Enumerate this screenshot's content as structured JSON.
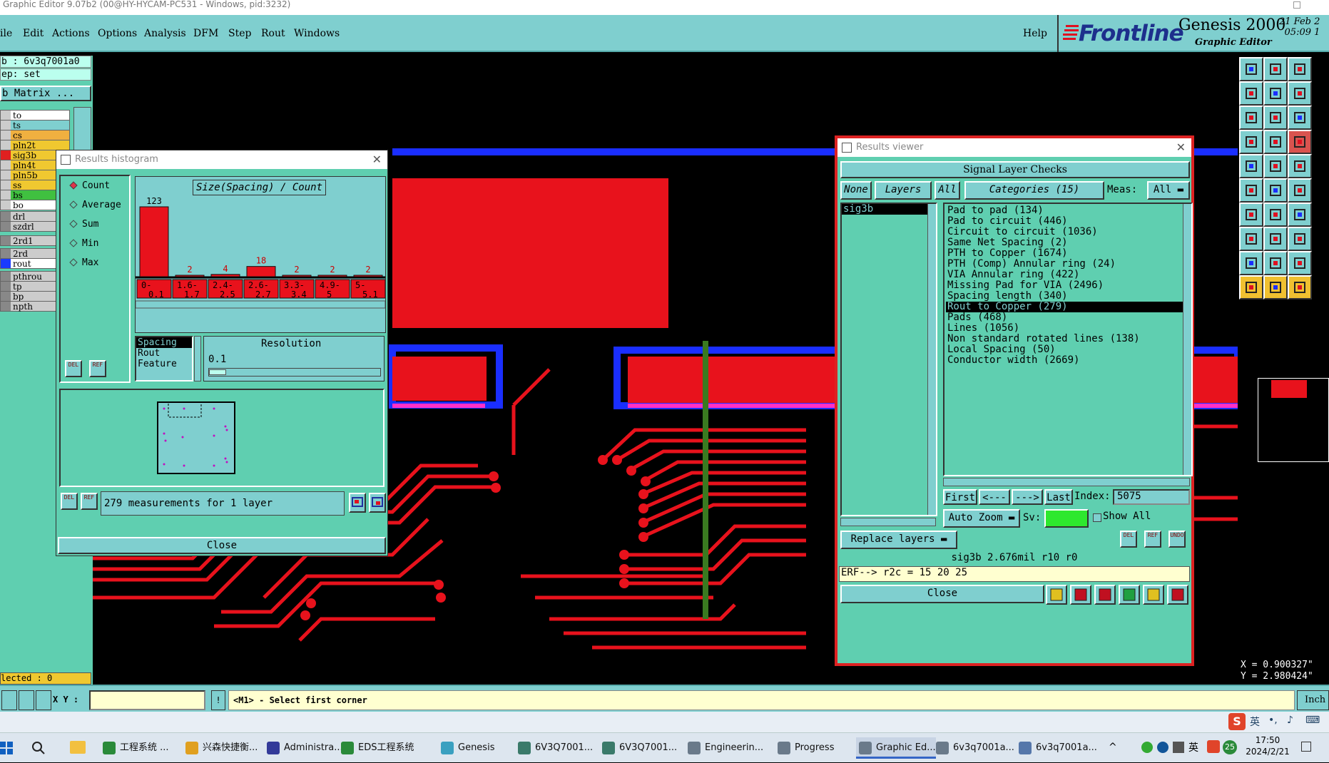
{
  "window_title": "Graphic Editor 9.07b2 (00@HY-HYCAM-PC531 - Windows, pid:3232)",
  "menu": {
    "items": [
      "ile",
      "Edit",
      "Actions",
      "Options",
      "Analysis",
      "DFM",
      "Step",
      "Rout",
      "Windows"
    ],
    "help": "Help"
  },
  "brand": {
    "logo": "Frontline",
    "product": "Genesis 2000",
    "subtitle": "Graphic Editor",
    "date_line1": "21 Feb 2",
    "date_line2": "05:09 1"
  },
  "left_panel": {
    "job": "b : 6v3q7001a0",
    "step": "ep: set",
    "matrix": "b Matrix ...",
    "layers": [
      {
        "name": "to",
        "bg": "#ffffff",
        "sw": "#cccccc"
      },
      {
        "name": "ts",
        "bg": "#7fcfcf",
        "sw": "#cccccc"
      },
      {
        "name": "cs",
        "bg": "#f0b040",
        "sw": "#cccccc"
      },
      {
        "name": "pln2t",
        "bg": "#f0c830",
        "sw": "#cccccc"
      },
      {
        "name": "sig3b",
        "bg": "#f0c830",
        "sw": "#e02020"
      },
      {
        "name": "pln4t",
        "bg": "#f0c830",
        "sw": "#cccccc"
      },
      {
        "name": "pln5b",
        "bg": "#f0c830",
        "sw": "#cccccc"
      },
      {
        "name": "ss",
        "bg": "#f0c830",
        "sw": "#cccccc"
      },
      {
        "name": "bs",
        "bg": "#40c040",
        "sw": "#cccccc"
      },
      {
        "name": "bo",
        "bg": "#ffffff",
        "sw": "#cccccc"
      },
      {
        "name": "drl",
        "bg": "#cccccc",
        "sw": "#888888"
      },
      {
        "name": "szdrl",
        "bg": "#cccccc",
        "sw": "#888888"
      },
      {
        "name": "2rd1",
        "bg": "#cccccc",
        "sw": "#888888"
      },
      {
        "name": "2rd",
        "bg": "#cccccc",
        "sw": "#888888"
      },
      {
        "name": "rout",
        "bg": "#ffffff",
        "sw": "#1a3aff"
      },
      {
        "name": "pthrou",
        "bg": "#cccccc",
        "sw": "#888888"
      },
      {
        "name": "tp",
        "bg": "#cccccc",
        "sw": "#888888"
      },
      {
        "name": "bp",
        "bg": "#cccccc",
        "sw": "#888888"
      },
      {
        "name": "npth",
        "bg": "#cccccc",
        "sw": "#888888"
      }
    ],
    "selected": "lected : 0"
  },
  "histogram": {
    "title": "Results histogram",
    "modes": [
      "Count",
      "Average",
      "Sum",
      "Min",
      "Max"
    ],
    "selected_mode": "Count",
    "chart_title": "Size(Spacing) / Count",
    "fields": [
      "Spacing",
      "Rout",
      "Feature"
    ],
    "resolution_label": "Resolution",
    "resolution_value": "0.1",
    "summary": "279 measurements for 1 layer",
    "close": "Close",
    "del": "DEL",
    "ref": "REF"
  },
  "chart_data": {
    "type": "bar",
    "title": "Size(Spacing) / Count",
    "categories": [
      "0-0.1",
      "1.6-1.7",
      "2.4-2.5",
      "2.6-2.7",
      "3.3-3.4",
      "4.9-5",
      "5-5.1"
    ],
    "values": [
      123,
      2,
      4,
      18,
      2,
      2,
      2
    ],
    "ylim": [
      0,
      123
    ]
  },
  "viewer": {
    "title": "Results viewer",
    "header": "Signal Layer Checks",
    "none": "None",
    "layers": "Layers",
    "all": "All",
    "categories_btn": "Categories (15)",
    "meas_label": "Meas:",
    "meas_value": "All",
    "layer_list": [
      "sig3b"
    ],
    "categories": [
      "Pad to pad (134)",
      "Pad to circuit (446)",
      "Circuit to circuit (1036)",
      "Same Net Spacing (2)",
      "PTH to Copper (1674)",
      "PTH (Comp) Annular ring (24)",
      "VIA Annular ring (422)",
      "Missing Pad for VIA (2496)",
      "Spacing length (340)",
      "Rout to Copper (279)",
      "Pads (468)",
      "Lines (1056)",
      "Non standard rotated lines (138)",
      "Local Spacing (50)",
      "Conductor width (2669)"
    ],
    "selected_category": "Rout to Copper (279)",
    "first": "First",
    "prev": "<---",
    "next": "--->",
    "last": "Last",
    "index_label": "Index:",
    "index_value": "5075",
    "auto_zoom": "Auto Zoom",
    "sv_label": "Sv:",
    "show_all": "Show All",
    "replace_layers": "Replace layers",
    "status": "sig3b 2.676mil  r10  r0",
    "erf": "ERF--> r2c = 15 20 25",
    "close": "Close",
    "del": "DEL",
    "ref": "REF",
    "undo": "UNDO"
  },
  "coords": {
    "x": "X = 0.900327\"",
    "y": "Y = 2.980424\""
  },
  "cmdbar": {
    "xy_label": "X Y :",
    "message": "<M1> - Select first corner",
    "units": "Inch"
  },
  "taskbar": {
    "tasks": [
      {
        "label": "工程系统 ...",
        "color": "#2a8a3a"
      },
      {
        "label": "兴森快捷衡...",
        "color": "#e0a020"
      },
      {
        "label": "Administra...",
        "color": "#333a99"
      },
      {
        "label": "EDS工程系统",
        "color": "#2a8a3a"
      },
      {
        "label": "Genesis",
        "color": "#3aa0c0"
      },
      {
        "label": "6V3Q7001...",
        "color": "#3a7a6a"
      },
      {
        "label": "6V3Q7001...",
        "color": "#3a7a6a"
      },
      {
        "label": "Engineerin...",
        "color": "#6a7a8a"
      },
      {
        "label": "Progress",
        "color": "#6a7a8a"
      },
      {
        "label": "Graphic Ed...",
        "color": "#6a7a8a"
      },
      {
        "label": "6v3q7001a...",
        "color": "#6a7a8a"
      },
      {
        "label": "6v3q7001a...",
        "color": "#5577aa"
      }
    ],
    "ime": "英",
    "lang": "英",
    "badge": "25",
    "time": "17:50",
    "date": "2024/2/21"
  },
  "colors": {
    "panel": "#5fcfb0",
    "button": "#7fcfcf",
    "copper": "#e8121c",
    "rout": "#1a2eff",
    "magenta": "#ff30c8"
  }
}
